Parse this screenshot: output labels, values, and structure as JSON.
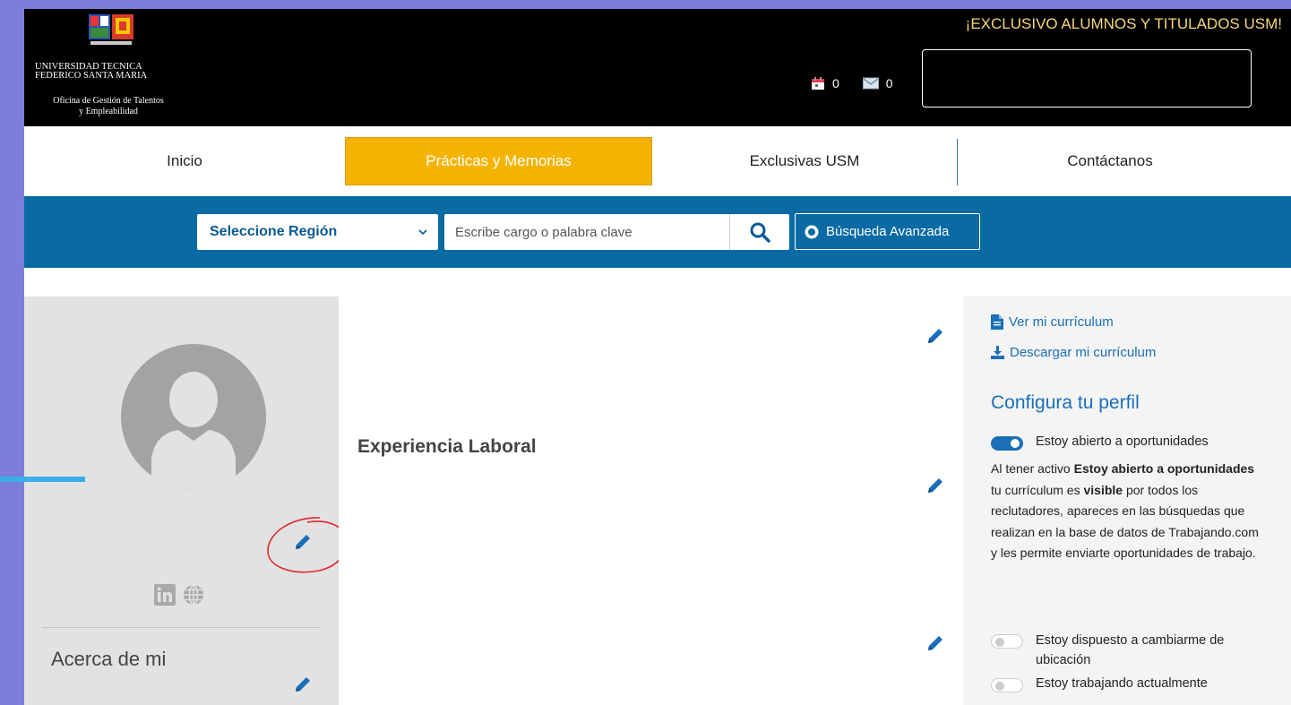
{
  "header": {
    "logo_line1": "UNIVERSIDAD TECNICA",
    "logo_line2": "FEDERICO SANTA MARIA",
    "logo_sub1": "Oficina de Gestión de Talentos",
    "logo_sub2": "y Empleabilidad",
    "exclusive": "¡EXCLUSIVO ALUMNOS Y TITULADOS USM!",
    "calendar_count": "0",
    "mail_count": "0"
  },
  "nav": {
    "items": [
      {
        "label": "Inicio"
      },
      {
        "label": "Prácticas y Memorias"
      },
      {
        "label": "Exclusivas USM"
      },
      {
        "label": "Contáctanos"
      }
    ]
  },
  "search": {
    "region_label": "Seleccione Región",
    "keyword_placeholder": "Escribe cargo o palabra clave",
    "advanced_label": "Búsqueda Avanzada"
  },
  "profile": {
    "about_title": "Acerca de mi"
  },
  "main": {
    "experience_title": "Experiencia Laboral"
  },
  "sidebar": {
    "view_cv": "Ver mi currículum",
    "download_cv": "Descargar mi currículum",
    "config_title": "Configura tu perfil",
    "toggle_open": "Estoy abierto a oportunidades",
    "desc_1": "Al tener activo ",
    "desc_bold1": "Estoy abierto a oportunidades",
    "desc_2": " tu currículum es ",
    "desc_bold2": "visible",
    "desc_3": " por todos los reclutadores, apareces en las búsquedas que realizan en la base de datos de Trabajando.com y les permite enviarte oportunidades de trabajo.",
    "toggle_relocate": "Estoy dispuesto a cambiarme de ubicación",
    "toggle_working": "Estoy trabajando actualmente"
  },
  "colors": {
    "accent": "#f5b301",
    "primary": "#0a6aa4",
    "link": "#1a6fb8",
    "annotation": "#e0282c"
  }
}
